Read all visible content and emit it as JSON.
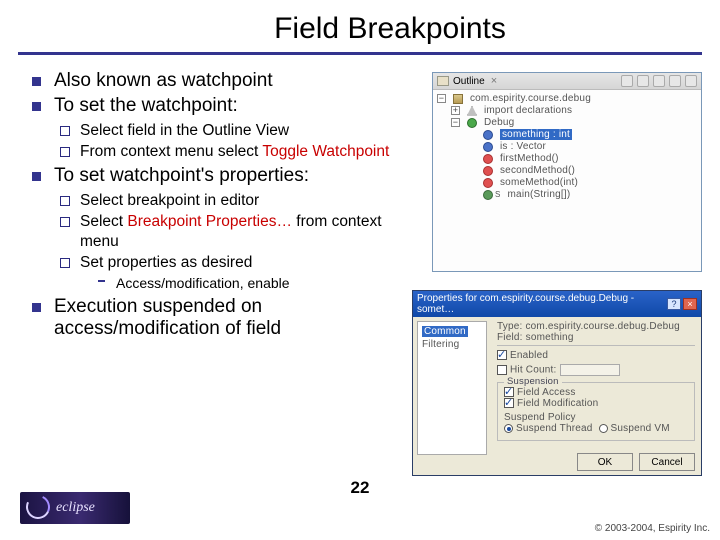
{
  "title": "Field Breakpoints",
  "bullets": {
    "b1": "Also known as watchpoint",
    "b2": "To set the watchpoint:",
    "b2s1": "Select field in the Outline View",
    "b2s2a": "From context menu select ",
    "b2s2b": "Toggle Watchpoint",
    "b3": "To set watchpoint's properties:",
    "b3s1": "Select breakpoint in editor",
    "b3s2a": "Select ",
    "b3s2b": "Breakpoint Properties…",
    "b3s2c": " from context menu",
    "b3s3": "Set properties as desired",
    "b3s3s1": "Access/modification, enable",
    "b4": "Execution suspended on access/modification of field"
  },
  "outline": {
    "tab": "Outline",
    "close": "×",
    "pkg": "com.espirity.course.debug",
    "imports": "import declarations",
    "cls": "Debug",
    "field": "something : int",
    "m1": "is : Vector",
    "m2": "firstMethod()",
    "m3": "secondMethod()",
    "m4": "someMethod(int)",
    "m5": "main(String[])",
    "ssup": "S"
  },
  "props": {
    "title": "Properties for com.espirity.course.debug.Debug - somet…",
    "left1": "Common",
    "left2": "Filtering",
    "type_label": "Type:",
    "type_val": "com.espirity.course.debug.Debug",
    "field_label": "Field:",
    "field_val": "something",
    "enabled": "Enabled",
    "hitcount": "Hit Count:",
    "suspension": "Suspension",
    "fa": "Field Access",
    "fm": "Field Modification",
    "sp": "Suspend Policy",
    "st": "Suspend Thread",
    "sv": "Suspend VM",
    "ok": "OK",
    "cancel": "Cancel"
  },
  "footer": {
    "page": "22",
    "copyright": "© 2003-2004, Espirity Inc.",
    "logo": "eclipse"
  }
}
